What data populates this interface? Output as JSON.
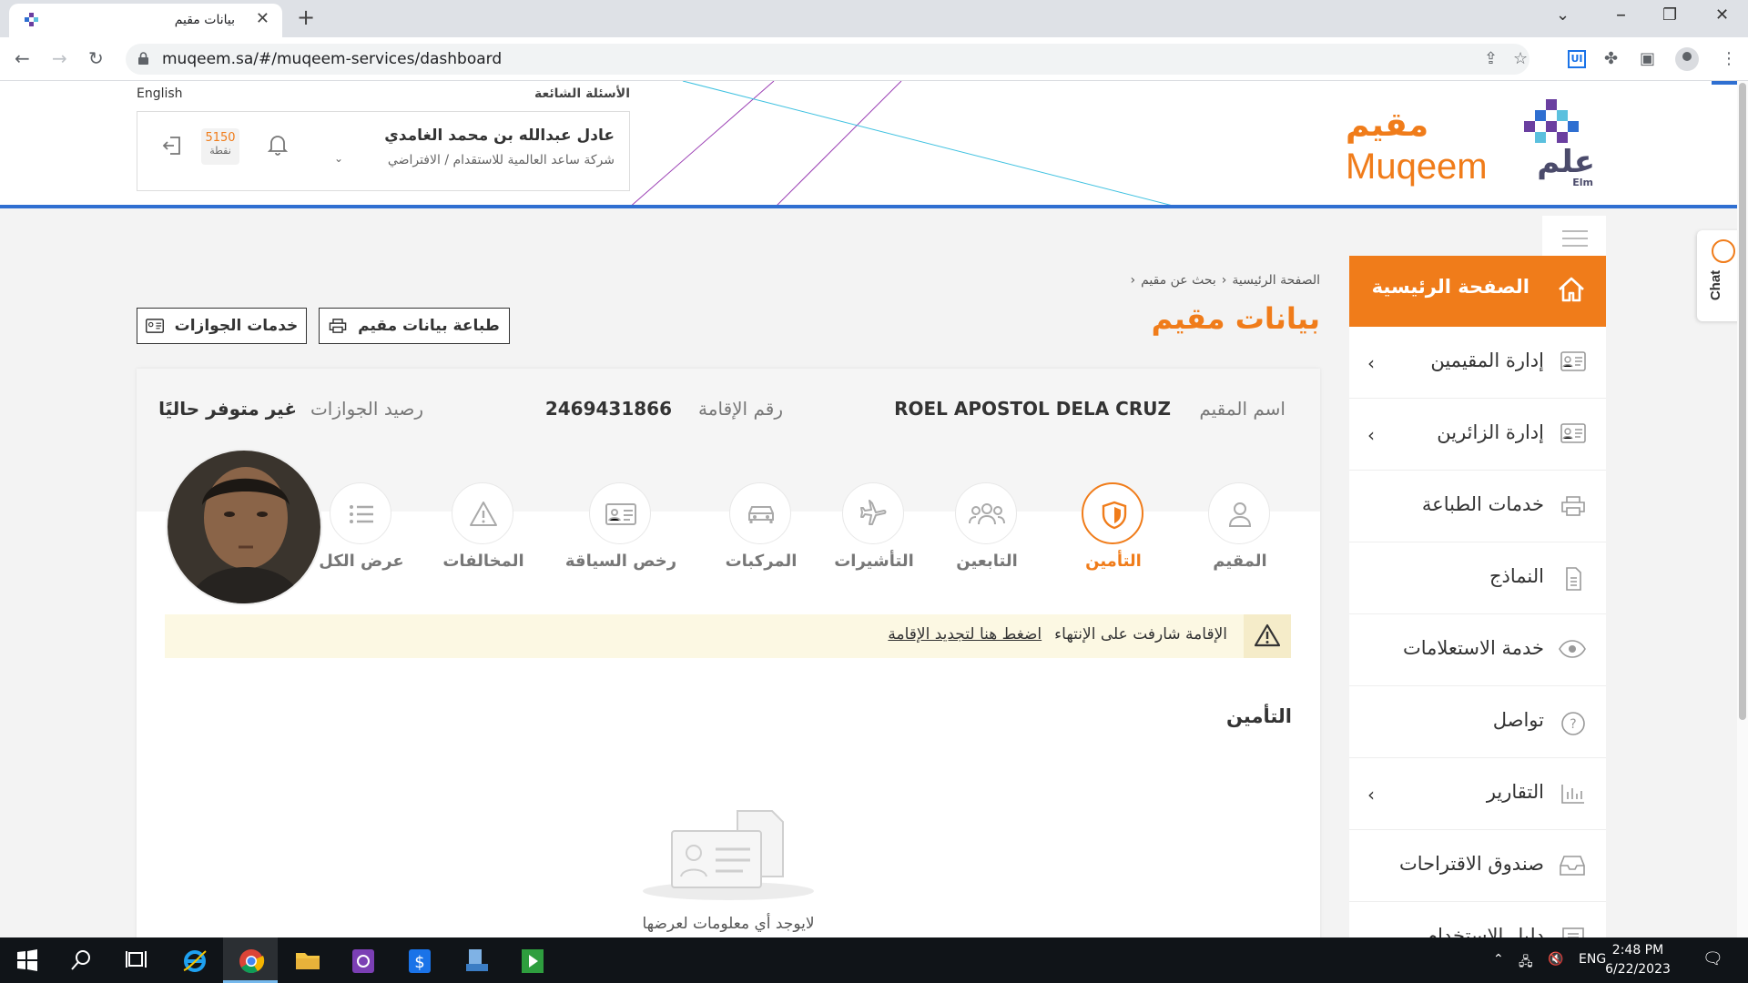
{
  "browser": {
    "tab_title": "بيانات مقيم",
    "url": "muqeem.sa/#/muqeem-services/dashboard",
    "ext_label": "UI"
  },
  "header": {
    "logo_ar": "مقيم",
    "logo_en": "Muqeem",
    "elm_ar": "علم",
    "elm_en": "Elm",
    "faq": "الأسئلة الشائعة",
    "language": "English",
    "user_name": "عادل عبدالله بن محمد الغامدي",
    "company": "شركة ساعد العالمية للاستقدام / الافتراضي",
    "points_value": "5150",
    "points_label": "نقطة"
  },
  "sidebar": {
    "home": "الصفحة الرئيسية",
    "items": [
      {
        "label": "إدارة المقيمين",
        "icon": "id-card-icon",
        "expandable": true
      },
      {
        "label": "إدارة الزائرين",
        "icon": "id-card-icon",
        "expandable": true
      },
      {
        "label": "خدمات الطباعة",
        "icon": "printer-icon",
        "expandable": false
      },
      {
        "label": "النماذج",
        "icon": "document-icon",
        "expandable": false
      },
      {
        "label": "خدمة الاستعلامات",
        "icon": "eye-icon",
        "expandable": false
      },
      {
        "label": "تواصل",
        "icon": "help-circle-icon",
        "expandable": false
      },
      {
        "label": "التقارير",
        "icon": "bar-chart-icon",
        "expandable": true
      },
      {
        "label": "صندوق الاقتراحات",
        "icon": "inbox-icon",
        "expandable": false
      },
      {
        "label": "دليل الاستخدام",
        "icon": "book-icon",
        "expandable": false
      }
    ]
  },
  "chat": {
    "label": "Chat"
  },
  "breadcrumb": {
    "home": "الصفحة الرئيسية",
    "search": "بحث عن مقيم"
  },
  "page_title": "بيانات مقيم",
  "actions": {
    "print": "طباعة بيانات مقيم",
    "passports": "خدمات الجوازات"
  },
  "resident": {
    "name_label": "اسم المقيم",
    "name": "ROEL APOSTOL DELA CRUZ",
    "iqama_label": "رقم الإقامة",
    "iqama": "2469431866",
    "balance_label": "رصيد الجوازات",
    "balance": "غير متوفر حاليًا"
  },
  "tabs": [
    {
      "label": "المقيم",
      "icon": "person-icon"
    },
    {
      "label": "التأمين",
      "icon": "shield-icon",
      "active": true
    },
    {
      "label": "التابعين",
      "icon": "group-icon"
    },
    {
      "label": "التأشيرات",
      "icon": "plane-icon"
    },
    {
      "label": "المركبات",
      "icon": "car-icon"
    },
    {
      "label": "رخص السياقة",
      "icon": "license-icon"
    },
    {
      "label": "المخالفات",
      "icon": "warning-icon"
    },
    {
      "label": "عرض الكل",
      "icon": "list-icon"
    }
  ],
  "alert": {
    "text": "الإقامة شارفت على الإنتهاء",
    "link": "اضغط هنا لتجديد الإقامة"
  },
  "section": {
    "title": "التأمين",
    "empty": "لايوجد أي معلومات لعرضها"
  },
  "taskbar": {
    "lang": "ENG",
    "time": "2:48 PM",
    "date": "6/22/2023"
  },
  "colors": {
    "accent": "#f07c1a",
    "header_line": "#2f6fd1",
    "alert_bg": "#fcf8e3"
  }
}
